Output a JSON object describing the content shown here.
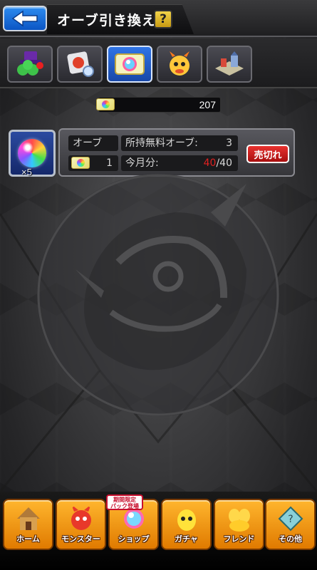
{
  "header": {
    "title": "オーブ引き換え",
    "help_label": "?"
  },
  "tabs": [
    {
      "icon": "clover-hat-icon"
    },
    {
      "icon": "item-bag-icon"
    },
    {
      "icon": "orb-ticket-icon",
      "active": true
    },
    {
      "icon": "dragon-chick-icon"
    },
    {
      "icon": "town-map-icon"
    }
  ],
  "currency": {
    "icon": "orb-ticket-icon",
    "value": "207"
  },
  "item": {
    "quantity": "×5",
    "name_label": "オーブ",
    "free_orbs_label": "所持無料オーブ:",
    "free_orbs_value": "3",
    "cost": "1",
    "monthly_label": "今月分:",
    "monthly_used": "40",
    "monthly_limit": "/40",
    "status_button": "売切れ",
    "colors": {
      "used": "#e02020",
      "status": "#d8201e"
    }
  },
  "bottom_nav": {
    "promo": "期間限定\nパック登場",
    "items": [
      {
        "label": "ホーム",
        "icon": "house-icon"
      },
      {
        "label": "モンスター",
        "icon": "monster-icon"
      },
      {
        "label": "ショップ",
        "icon": "shop-orb-icon"
      },
      {
        "label": "ガチャ",
        "icon": "gacha-egg-icon"
      },
      {
        "label": "フレンド",
        "icon": "friends-icon"
      },
      {
        "label": "その他",
        "icon": "other-icon"
      }
    ]
  }
}
